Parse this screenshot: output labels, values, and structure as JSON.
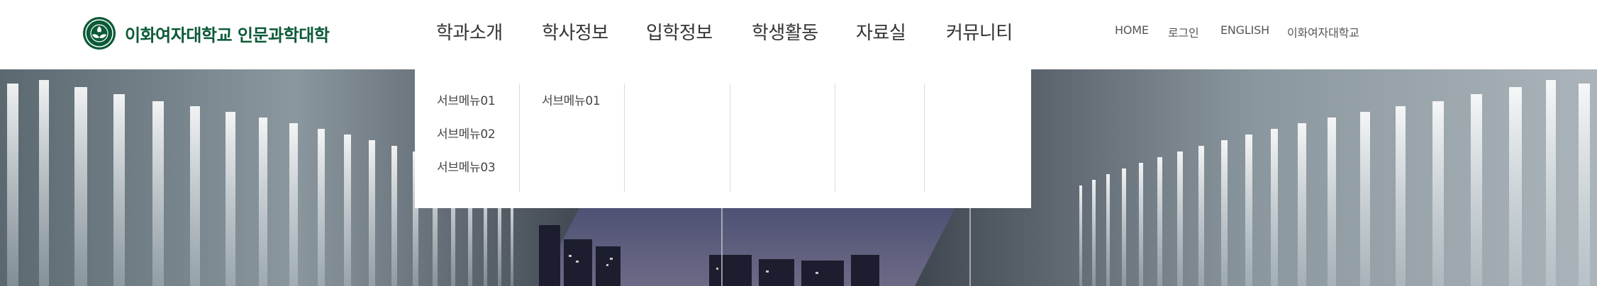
{
  "header": {
    "logo_text": "이화여자대학교 인문과학대학",
    "logo_icon": "university-emblem-icon",
    "brand_color": "#0b5a37"
  },
  "gnb": {
    "items": [
      {
        "label": "학과소개"
      },
      {
        "label": "학사정보"
      },
      {
        "label": "입학정보"
      },
      {
        "label": "학생활동"
      },
      {
        "label": "자료실"
      },
      {
        "label": "커뮤니티"
      }
    ]
  },
  "util": {
    "links": [
      {
        "label": "HOME"
      },
      {
        "label": "로그인"
      },
      {
        "label": "ENGLISH"
      },
      {
        "label": "이화여자대학교"
      }
    ]
  },
  "dropdown": {
    "columns": [
      {
        "links": [
          "서브메뉴01",
          "서브메뉴02",
          "서브메뉴03"
        ]
      },
      {
        "links": [
          "서브메뉴01"
        ]
      },
      {
        "links": []
      },
      {
        "links": []
      },
      {
        "links": []
      },
      {
        "links": []
      }
    ]
  }
}
